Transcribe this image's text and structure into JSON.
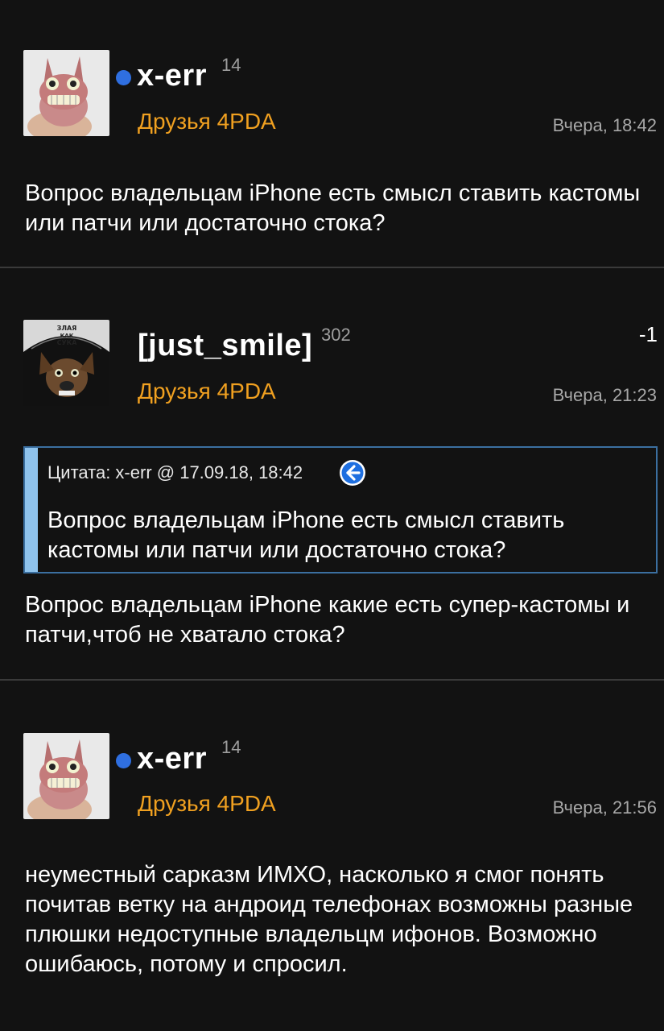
{
  "posts": [
    {
      "author": "x-err",
      "reputation": "14",
      "group": "Друзья 4PDA",
      "date": "Вчера, 18:42",
      "text": "Вопрос владельцам iPhone есть смысл ставить кастомы или патчи или достаточно стока?",
      "online": true
    },
    {
      "author": "[just_smile]",
      "reputation": "302",
      "group": "Друзья 4PDA",
      "date": "Вчера, 21:23",
      "rating": "-1",
      "quote": {
        "header": "Цитата: x-err @ 17.09.18, 18:42",
        "text": "Вопрос владельцам iPhone есть смысл ставить кастомы или патчи или достаточно стока?"
      },
      "text": "Вопрос владельцам iPhone какие есть супер-кастомы и патчи,чтоб не хватало стока?",
      "avatar_caption": "ЗЛАЯ КАК СУКА"
    },
    {
      "author": "x-err",
      "reputation": "14",
      "group": "Друзья 4PDA",
      "date": "Вчера, 21:56",
      "text": "неуместный сарказм ИМХО, насколько я смог понять почитав ветку на андроид телефонах возможны разные плюшки недоступные владельцм ифонов. Возможно ошибаюсь, потому и спросил.",
      "online": true
    }
  ],
  "colors": {
    "background": "#121212",
    "group": "#f0a020",
    "online_dot": "#2f6fe0",
    "quote_bar": "#8fc3ec",
    "quote_border": "#3b6fa0"
  },
  "icons": {
    "quote_link": "arrow-left-circle-icon",
    "online": "online-dot-icon"
  }
}
